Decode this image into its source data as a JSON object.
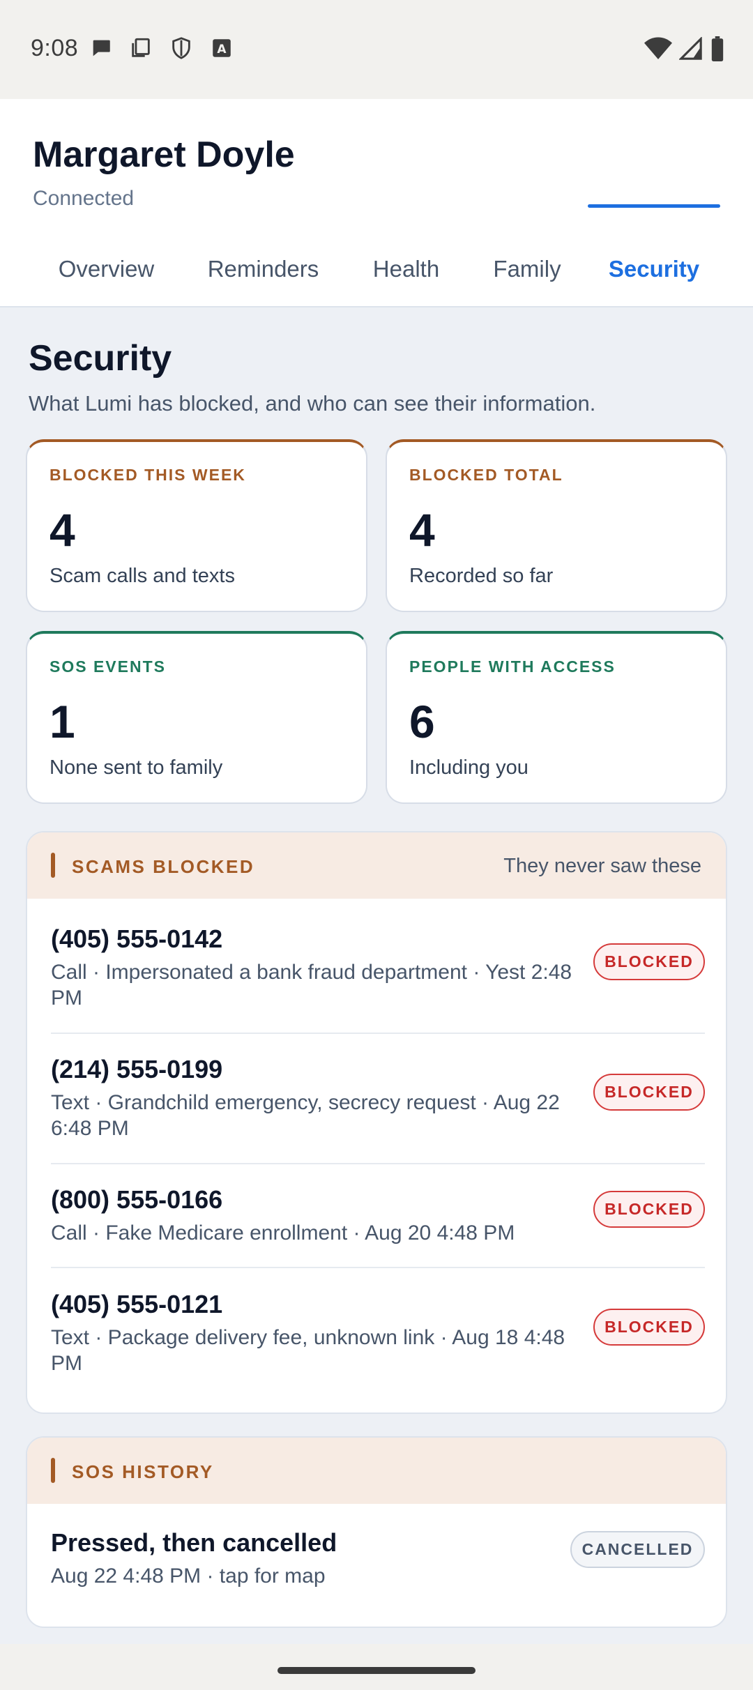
{
  "status_bar": {
    "time": "9:08",
    "left_icons": [
      "chat-bubble-icon",
      "copy-icon",
      "shield-icon",
      "keyboard-a-icon"
    ],
    "right_icons": [
      "wifi-icon",
      "cell-signal-icon",
      "battery-icon"
    ]
  },
  "header": {
    "name": "Margaret Doyle",
    "status": "Connected"
  },
  "tabs": [
    {
      "label": "Overview",
      "active": false
    },
    {
      "label": "Reminders",
      "active": false
    },
    {
      "label": "Health",
      "active": false
    },
    {
      "label": "Family",
      "active": false
    },
    {
      "label": "Security",
      "active": true
    }
  ],
  "security": {
    "title": "Security",
    "subtitle": "What Lumi has blocked, and who can see their information."
  },
  "stats": [
    {
      "label": "BLOCKED THIS WEEK",
      "value": "4",
      "caption": "Scam calls and texts",
      "tone": "warn"
    },
    {
      "label": "BLOCKED TOTAL",
      "value": "4",
      "caption": "Recorded so far",
      "tone": "warn"
    },
    {
      "label": "SOS EVENTS",
      "value": "1",
      "caption": "None sent to family",
      "tone": "ok"
    },
    {
      "label": "PEOPLE WITH ACCESS",
      "value": "6",
      "caption": "Including you",
      "tone": "ok"
    }
  ],
  "scams": {
    "title": "SCAMS BLOCKED",
    "note": "They never saw these",
    "items": [
      {
        "number": "(405) 555-0142",
        "detail": "Call · Impersonated a bank fraud department · Yest 2:48 PM",
        "badge": "BLOCKED"
      },
      {
        "number": "(214) 555-0199",
        "detail": "Text · Grandchild emergency, secrecy request · Aug 22 6:48 PM",
        "badge": "BLOCKED"
      },
      {
        "number": "(800) 555-0166",
        "detail": "Call · Fake Medicare enrollment · Aug 20 4:48 PM",
        "badge": "BLOCKED"
      },
      {
        "number": "(405) 555-0121",
        "detail": "Text · Package delivery fee, unknown link · Aug 18 4:48 PM",
        "badge": "BLOCKED"
      }
    ]
  },
  "sos": {
    "title": "SOS HISTORY",
    "items": [
      {
        "title": "Pressed, then cancelled",
        "detail": "Aug 22 4:48 PM · tap for map",
        "badge": "CANCELLED"
      }
    ]
  },
  "colors": {
    "accent": "#1d6fe0",
    "warn": "#a35a25",
    "ok": "#1f7a5c",
    "danger": "#c62828"
  }
}
